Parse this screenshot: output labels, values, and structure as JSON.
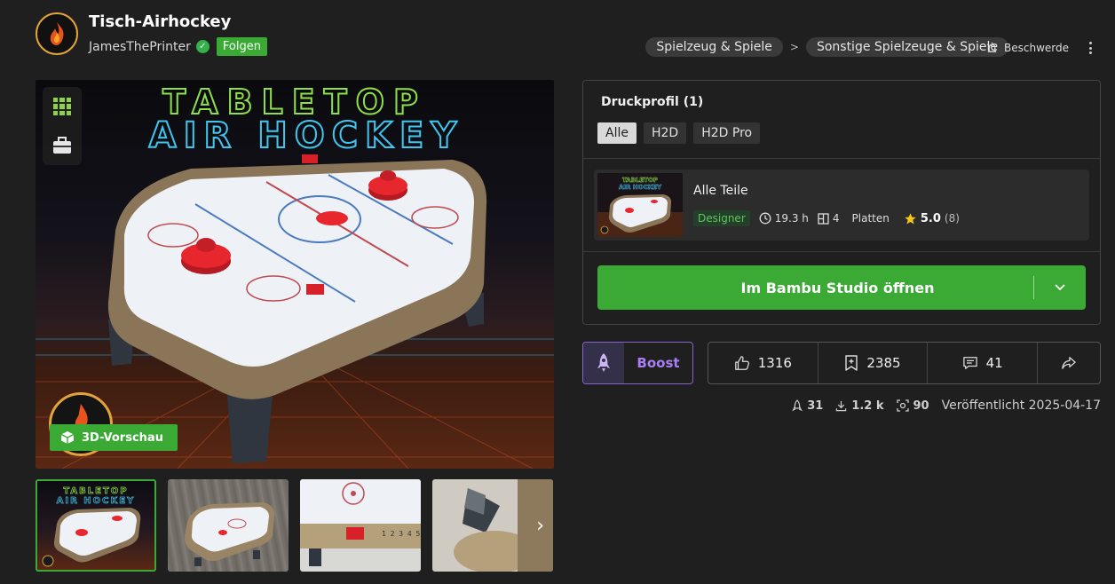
{
  "header": {
    "title": "Tisch-Airhockey",
    "author": "JamesThePrinter",
    "follow_label": "Folgen",
    "breadcrumbs": [
      "Spielzeug & Spiele",
      "Sonstige Spielzeuge & Spiele"
    ],
    "breadcrumb_separator": ">",
    "report_label": "Beschwerde"
  },
  "hero": {
    "neon_line1": "TABLETOP",
    "neon_line2": "AIR HOCKEY",
    "preview_label": "3D-Vorschau"
  },
  "print_profile": {
    "title": "Druckprofil (1)",
    "filters": [
      "Alle",
      "H2D",
      "H2D Pro"
    ],
    "active_filter": "Alle",
    "profile": {
      "name": "Alle Teile",
      "badge": "Designer",
      "print_time": "19.3 h",
      "plates_count": "4",
      "plates_label": "Platten",
      "rating": "5.0",
      "rating_count": "(8)"
    },
    "open_button": "Im Bambu Studio öffnen"
  },
  "actions": {
    "boost_label": "Boost",
    "likes": "1316",
    "collects": "2385",
    "comments": "41"
  },
  "meta": {
    "boosts": "31",
    "downloads": "1.2 k",
    "prints": "90",
    "published": "Veröffentlicht 2025-04-17"
  },
  "colors": {
    "accent_green": "#3aaa35",
    "boost_purple": "#a97ef5",
    "background": "#1f1f1f"
  }
}
